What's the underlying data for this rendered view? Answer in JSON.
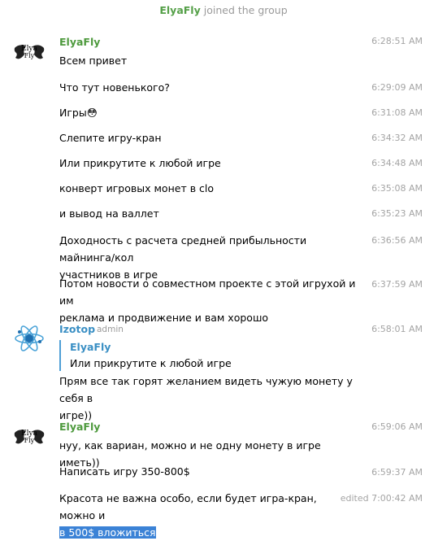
{
  "service": {
    "name": "ElyaFly",
    "text": "joined the group"
  },
  "avatars": {
    "elyafly_top": "Elya",
    "elyafly_bottom": "Fly"
  },
  "group1": {
    "sender": "ElyaFly",
    "messages": [
      {
        "text": "Всем привет",
        "time": "6:28:51 AM"
      },
      {
        "text": "Что тут новенького?",
        "time": "6:29:09 AM"
      },
      {
        "text": "Игры",
        "emoji": "😳",
        "time": "6:31:08 AM"
      },
      {
        "text": "Слепите игру-кран",
        "time": "6:34:32 AM"
      },
      {
        "text": "Или прикрутите к любой игре",
        "time": "6:34:48 AM"
      },
      {
        "text": "конверт игровых монет в clo",
        "time": "6:35:08 AM"
      },
      {
        "text": "и вывод на валлет",
        "time": "6:35:23 AM"
      },
      {
        "line1": "Доходность с расчета средней прибыльности майнинга/кол",
        "line2": "участников в игре",
        "time": "6:36:56 AM"
      },
      {
        "line1": "Потом новости о совместном проекте с этой игрухой и им",
        "line2": "реклама и продвижение и вам хорошо",
        "time": "6:37:59 AM"
      }
    ]
  },
  "group2": {
    "sender": "Izotop",
    "role": "admin",
    "time": "6:58:01 AM",
    "reply": {
      "name": "ElyaFly",
      "text": "Или прикрутите к любой игре"
    },
    "line1": "Прям все так горят желанием видеть чужую монету у себя в",
    "line2": "игре))"
  },
  "group3": {
    "sender": "ElyaFly",
    "messages": [
      {
        "text": "нуу, как вариан, можно и не одну монету в игре иметь))",
        "time": "6:59:06 AM"
      },
      {
        "text": "Написать игру 350-800$",
        "time": "6:59:37 AM"
      },
      {
        "line1": "Красота не важна особо, если будет игра-кран, можно и",
        "line2_selected": "в 500$ вложиться",
        "time": "edited 7:00:42 AM"
      }
    ]
  },
  "colors": {
    "sender_green": "#4e9a3e",
    "sender_blue": "#3a8fc4",
    "selection": "#3b82d6",
    "reply_bar": "#4e9fd6"
  }
}
